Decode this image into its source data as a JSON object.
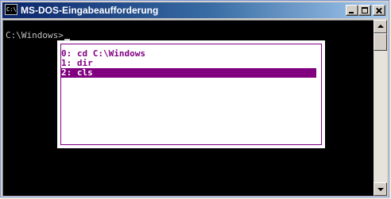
{
  "window": {
    "title": "MS-DOS-Eingabeaufforderung",
    "icon": "ms-dos-console-icon",
    "controls": [
      "minimize",
      "maximize",
      "close"
    ]
  },
  "console": {
    "prompt": "C:\\Windows>"
  },
  "history_popup": {
    "items": [
      {
        "text": "0: cd C:\\Windows",
        "selected": false
      },
      {
        "text": "1: dir",
        "selected": false
      },
      {
        "text": "2: cls",
        "selected": true
      }
    ]
  },
  "colors": {
    "console_bg": "#000000",
    "console_text": "#c0c0c0",
    "popup_bg": "#ffffff",
    "popup_accent": "#800080",
    "title_gradient_start": "#0a246a",
    "title_gradient_end": "#a6caf0"
  }
}
